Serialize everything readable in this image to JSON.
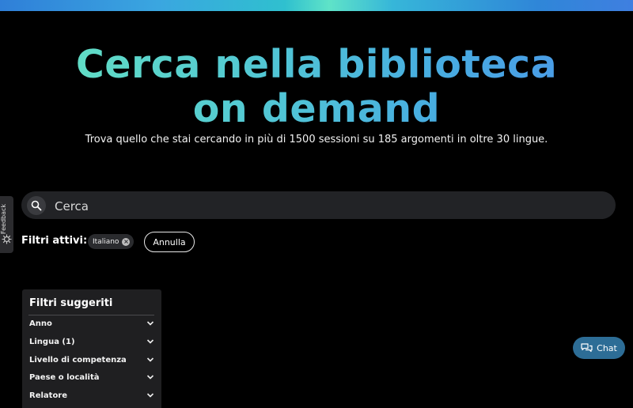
{
  "hero": {
    "title": "Cerca nella biblioteca on demand",
    "subtitle": "Trova quello che stai cercando in più di 1500 sessioni su 185 argomenti in oltre 30 lingue."
  },
  "search": {
    "placeholder": "Cerca",
    "value": ""
  },
  "feedback": {
    "label": "Feedback"
  },
  "active_filters": {
    "label": "Filtri attivi:",
    "chips": [
      "Italiano"
    ],
    "cancel_label": "Annulla"
  },
  "suggested_filters": {
    "heading": "Filtri suggeriti",
    "items": [
      "Anno",
      "Lingua (1)",
      "Livello di competenza",
      "Paese o località",
      "Relatore"
    ]
  },
  "chat": {
    "label": "Chat"
  },
  "colors": {
    "background": "#000000",
    "title_gradient_start": "#63e0c4",
    "title_gradient_end": "#4a9ae8",
    "chat_button": "#2d6d96",
    "panel": "#1f1f21"
  },
  "icons": {
    "search": "search-icon",
    "chip_remove": "close-circle-icon",
    "expand": "chevron-down-icon",
    "chat": "chat-bubbles-icon",
    "feedback": "feedback-icon"
  }
}
